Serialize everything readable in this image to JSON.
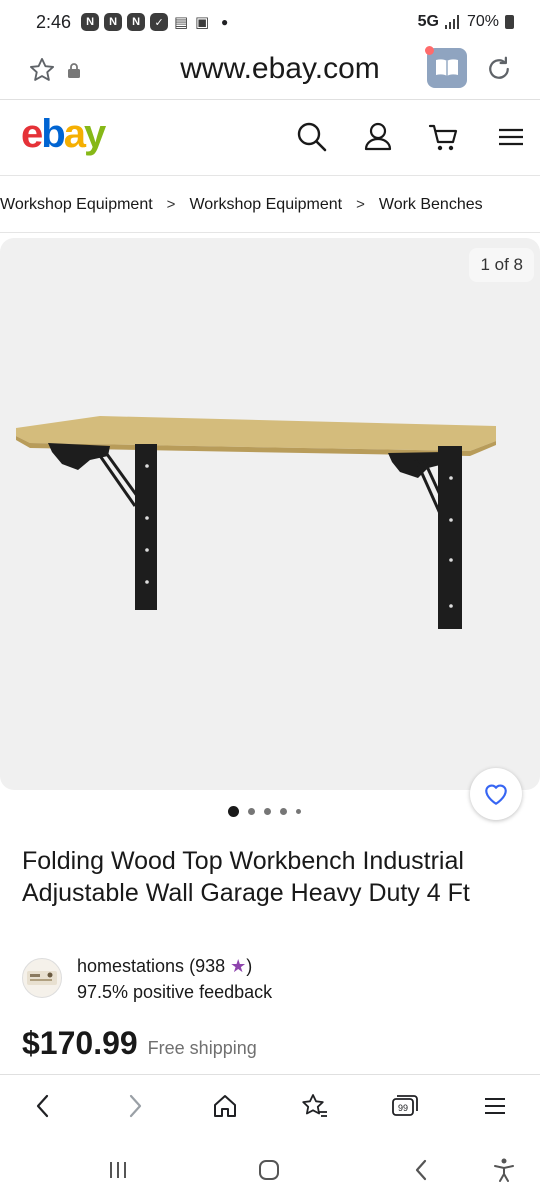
{
  "status_bar": {
    "time": "2:46",
    "network": "5G",
    "battery": "70%"
  },
  "browser": {
    "url": "www.ebay.com"
  },
  "site": {
    "logo_letters": [
      "e",
      "b",
      "a",
      "y"
    ]
  },
  "breadcrumb": [
    "Workshop Equipment",
    "Workshop Equipment",
    "Work Benches"
  ],
  "gallery": {
    "counter": "1 of 8",
    "current_index": 1,
    "total": 8
  },
  "listing": {
    "title": "Folding Wood Top Workbench Industrial Adjustable Wall Garage Heavy Duty 4 Ft",
    "seller_name": "homestations",
    "seller_score": "(938",
    "seller_score_end": ")",
    "feedback": "97.5% positive feedback",
    "price": "$170.99",
    "shipping": "Free shipping"
  },
  "colors": {
    "ebay_red": "#e53238",
    "ebay_blue": "#0064d2",
    "ebay_yellow": "#f5af02",
    "ebay_green": "#86b817",
    "watch_heart": "#3665f3",
    "seller_star": "#8e44ad"
  },
  "icons": {
    "header": [
      "search-icon",
      "account-icon",
      "cart-icon",
      "menu-icon"
    ],
    "toolbar": [
      "back-icon",
      "forward-icon",
      "home-icon",
      "bookmarks-icon",
      "tabs-icon",
      "menu-icon"
    ]
  }
}
